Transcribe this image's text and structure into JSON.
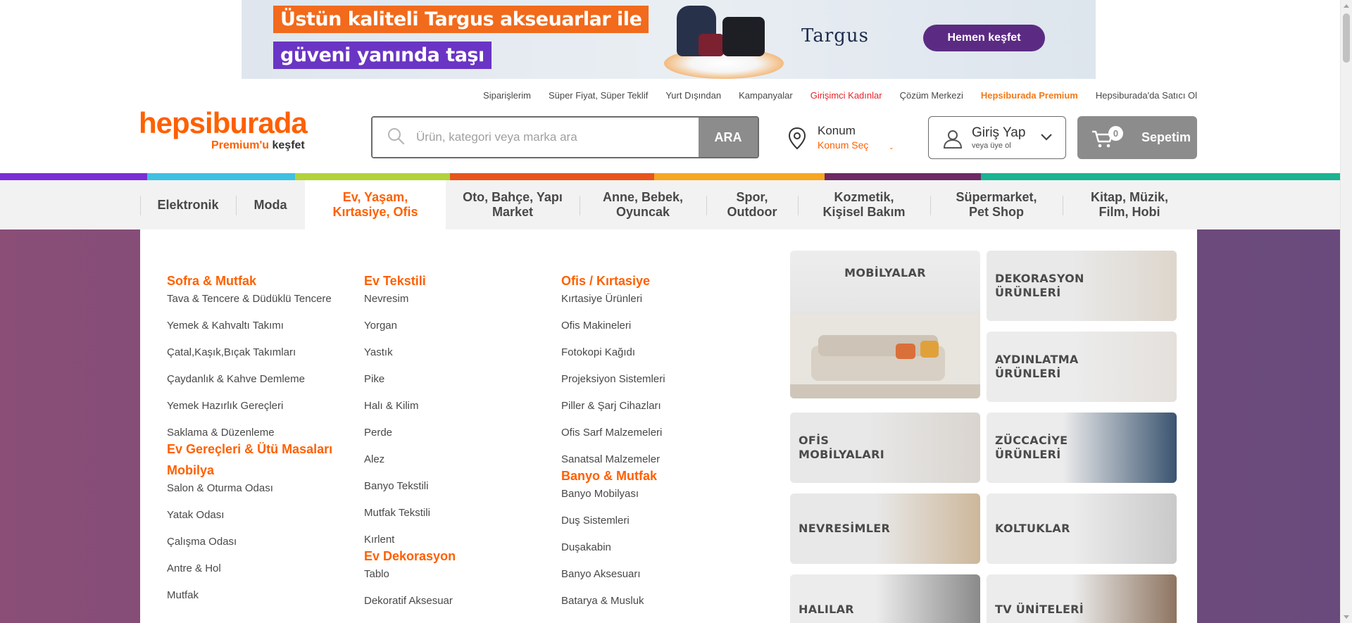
{
  "banner": {
    "line1": "Üstün kaliteli Targus akseuarlar ile",
    "line2": "güveni yanında taşı",
    "brand": "Targus",
    "cta": "Hemen keşfet"
  },
  "top_links": [
    {
      "label": "Siparişlerim",
      "style": "normal"
    },
    {
      "label": "Süper Fiyat, Süper Teklif",
      "style": "normal"
    },
    {
      "label": "Yurt Dışından",
      "style": "normal"
    },
    {
      "label": "Kampanyalar",
      "style": "normal"
    },
    {
      "label": "Girişimci Kadınlar",
      "style": "red"
    },
    {
      "label": "Çözüm Merkezi",
      "style": "normal"
    },
    {
      "label": "Hepsiburada Premium",
      "style": "orange"
    },
    {
      "label": "Hepsiburada'da Satıcı Ol",
      "style": "normal"
    }
  ],
  "header": {
    "logo": "hepsiburada",
    "premium_a": "Premium'u",
    "premium_b": "keşfet",
    "search_placeholder": "Ürün, kategori veya marka ara",
    "search_button": "ARA",
    "location_title": "Konum",
    "location_sub": "Konum Seç",
    "login_title": "Giriş Yap",
    "login_sub": "veya üye ol",
    "cart_label": "Sepetim",
    "cart_count": "0"
  },
  "stripe_colors": [
    "#7a2ed6",
    "#3fc0e0",
    "#b1d23a",
    "#e7551d",
    "#f6a623",
    "#6d2a63",
    "#1bb392"
  ],
  "categories": [
    {
      "label": "Elektronik",
      "active": false
    },
    {
      "label": "Moda",
      "active": false
    },
    {
      "label": "Ev, Yaşam,\nKırtasiye, Ofis",
      "active": true
    },
    {
      "label": "Oto, Bahçe, Yapı\nMarket",
      "active": false
    },
    {
      "label": "Anne, Bebek,\nOyuncak",
      "active": false
    },
    {
      "label": "Spor,\nOutdoor",
      "active": false
    },
    {
      "label": "Kozmetik,\nKişisel Bakım",
      "active": false
    },
    {
      "label": "Süpermarket,\nPet Shop",
      "active": false
    },
    {
      "label": "Kitap, Müzik,\nFilm, Hobi",
      "active": false
    }
  ],
  "menu_columns": [
    [
      {
        "type": "h",
        "label": "Sofra & Mutfak"
      },
      {
        "type": "i",
        "label": "Tava & Tencere & Düdüklü Tencere"
      },
      {
        "type": "i",
        "label": "Yemek & Kahvaltı Takımı"
      },
      {
        "type": "i",
        "label": "Çatal,Kaşık,Bıçak Takımları"
      },
      {
        "type": "i",
        "label": "Çaydanlık & Kahve Demleme"
      },
      {
        "type": "i",
        "label": "Yemek Hazırlık Gereçleri"
      },
      {
        "type": "i",
        "label": "Saklama & Düzenleme"
      },
      {
        "type": "h",
        "label": "Ev Gereçleri & Ütü Masaları"
      },
      {
        "type": "h",
        "label": "Mobilya"
      },
      {
        "type": "i",
        "label": "Salon & Oturma Odası"
      },
      {
        "type": "i",
        "label": "Yatak Odası"
      },
      {
        "type": "i",
        "label": "Çalışma Odası"
      },
      {
        "type": "i",
        "label": "Antre & Hol"
      },
      {
        "type": "i",
        "label": "Mutfak"
      }
    ],
    [
      {
        "type": "h",
        "label": "Ev Tekstili"
      },
      {
        "type": "i",
        "label": "Nevresim"
      },
      {
        "type": "i",
        "label": "Yorgan"
      },
      {
        "type": "i",
        "label": "Yastık"
      },
      {
        "type": "i",
        "label": "Pike"
      },
      {
        "type": "i",
        "label": "Halı & Kilim"
      },
      {
        "type": "i",
        "label": "Perde"
      },
      {
        "type": "i",
        "label": "Alez"
      },
      {
        "type": "i",
        "label": "Banyo Tekstili"
      },
      {
        "type": "i",
        "label": "Mutfak Tekstili"
      },
      {
        "type": "i",
        "label": "Kırlent"
      },
      {
        "type": "h",
        "label": "Ev Dekorasyon"
      },
      {
        "type": "i",
        "label": "Tablo"
      },
      {
        "type": "i",
        "label": "Dekoratif Aksesuar"
      }
    ],
    [
      {
        "type": "h",
        "label": "Ofis / Kırtasiye"
      },
      {
        "type": "i",
        "label": "Kırtasiye Ürünleri"
      },
      {
        "type": "i",
        "label": "Ofis Makineleri"
      },
      {
        "type": "i",
        "label": "Fotokopi Kağıdı"
      },
      {
        "type": "i",
        "label": "Projeksiyon Sistemleri"
      },
      {
        "type": "i",
        "label": "Piller & Şarj Cihazları"
      },
      {
        "type": "i",
        "label": "Ofis Sarf Malzemeleri"
      },
      {
        "type": "i",
        "label": "Sanatsal Malzemeler"
      },
      {
        "type": "h",
        "label": "Banyo & Mutfak"
      },
      {
        "type": "i",
        "label": "Banyo Mobilyası"
      },
      {
        "type": "i",
        "label": "Duş Sistemleri"
      },
      {
        "type": "i",
        "label": "Duşakabin"
      },
      {
        "type": "i",
        "label": "Banyo Aksesuarı"
      },
      {
        "type": "i",
        "label": "Batarya & Musluk"
      }
    ]
  ],
  "tiles": [
    {
      "label": "MOBİLYALAR",
      "icon": "sofa-image"
    },
    {
      "label": "DEKORASYON\nÜRÜNLERİ",
      "icon": "vase-image"
    },
    {
      "label": "AYDINLATMA\nÜRÜNLERİ",
      "icon": "lamp-image"
    },
    {
      "label": "OFİS\nMOBİLYALARI",
      "icon": "desk-image"
    },
    {
      "label": "ZÜCCACİYE\nÜRÜNLERİ",
      "icon": "plates-image"
    },
    {
      "label": "NEVRESİMLER",
      "icon": "bedding-image"
    },
    {
      "label": "KOLTUKLAR",
      "icon": "couch-image"
    },
    {
      "label": "HALILAR",
      "icon": "rug-image"
    },
    {
      "label": "TV ÜNİTELERİ",
      "icon": "tv-unit-image"
    }
  ]
}
